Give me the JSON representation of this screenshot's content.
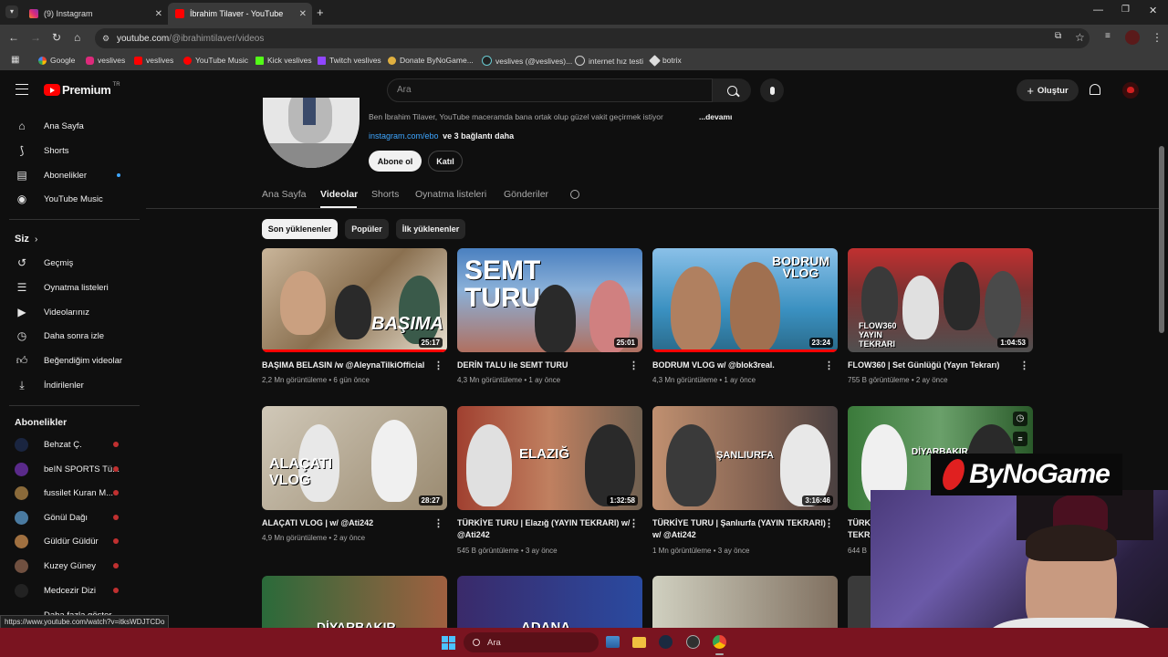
{
  "browser": {
    "tabs": [
      {
        "title": "(9) Instagram",
        "active": false
      },
      {
        "title": "İbrahim Tilaver - YouTube",
        "active": true
      }
    ],
    "url_main": "youtube.com",
    "url_path": "/@ibrahimtilaver/videos",
    "bookmarks": [
      "Google",
      "veslives",
      "veslives",
      "YouTube Music",
      "Kick veslives",
      "Twitch veslives",
      "Donate ByNoGame...",
      "veslives (@veslives)...",
      "internet hız testi",
      "botrix"
    ]
  },
  "youtube": {
    "logo_text": "Premium",
    "logo_sup": "TR",
    "search_placeholder": "Ara",
    "create_label": "Oluştur",
    "sidebar": {
      "main": [
        "Ana Sayfa",
        "Shorts",
        "Abonelikler",
        "YouTube Music"
      ],
      "you_header": "Siz",
      "you": [
        "Geçmiş",
        "Oynatma listeleri",
        "Videolarınız",
        "Daha sonra izle",
        "Beğendiğim videolar",
        "İndirilenler"
      ],
      "subs_header": "Abonelikler",
      "subs": [
        "Behzat Ç.",
        "beIN SPORTS Tü...",
        "fussilet Kuran M...",
        "Gönül Dağı",
        "Güldür Güldür",
        "Kuzey Güney",
        "Medcezir Dizi"
      ],
      "show_more": "Daha fazla göster"
    },
    "channel": {
      "description": "Ben İbrahim Tilaver, YouTube maceramda bana ortak olup güzel vakit geçirmek istiyor",
      "more": "...devamı",
      "link": "instagram.com/ebo",
      "link_more": "ve 3 bağlantı daha",
      "subscribe": "Abone ol",
      "join": "Katıl"
    },
    "channel_tabs": [
      "Ana Sayfa",
      "Videolar",
      "Shorts",
      "Oynatma listeleri",
      "Gönderiler"
    ],
    "active_channel_tab": "Videolar",
    "chips": [
      "Son yüklenenler",
      "Popüler",
      "İlk yüklenenler"
    ],
    "selected_chip": "Son yüklenenler",
    "videos": [
      {
        "title": "BAŞIMA BELASIN /w @AleynaTilkiOfficial",
        "views": "2,2 Mn görüntüleme",
        "age": "6 gün önce",
        "duration": "25:17",
        "thumb_text": "BAŞIMA",
        "watched_fraction": 1.0
      },
      {
        "title": "DERİN TALU ile SEMT TURU",
        "views": "4,3 Mn görüntüleme",
        "age": "1 ay önce",
        "duration": "25:01",
        "thumb_text": "SEMT TURU",
        "watched_fraction": 0
      },
      {
        "title": "BODRUM VLOG w/ @blok3real.",
        "views": "4,3 Mn görüntüleme",
        "age": "1 ay önce",
        "duration": "23:24",
        "thumb_text": "BODRUM VLOG",
        "watched_fraction": 1.0
      },
      {
        "title": "FLOW360 | Set Günlüğü (Yayın Tekrarı)",
        "views": "755 B görüntüleme",
        "age": "2 ay önce",
        "duration": "1:04:53",
        "thumb_text": "FLOW360 YAYIN TEKRARI",
        "watched_fraction": 0
      },
      {
        "title": "ALAÇATI VLOG | w/ @Ati242",
        "views": "4,9 Mn görüntüleme",
        "age": "2 ay önce",
        "duration": "28:27",
        "thumb_text": "ALAÇATI VLOG",
        "watched_fraction": 0
      },
      {
        "title": "TÜRKİYE TURU | Elazığ (YAYIN TEKRARI) w/ @Ati242",
        "views": "545 B görüntüleme",
        "age": "3 ay önce",
        "duration": "1:32:58",
        "thumb_text": "ELAZIĞ",
        "watched_fraction": 0
      },
      {
        "title": "TÜRKİYE TURU | Şanlıurfa (YAYIN TEKRARI) w/ @Ati242",
        "views": "1 Mn görüntüleme",
        "age": "3 ay önce",
        "duration": "3:16:46",
        "thumb_text": "ŞANLIURFA",
        "watched_fraction": 0
      },
      {
        "title": "TÜRKİYE TURU | Diyarbakır (YAYIN TEKRARI)",
        "views": "644 B",
        "age": "",
        "duration": "",
        "thumb_text": "DİYARBAKIR",
        "watched_fraction": 0
      }
    ],
    "row3_thumb_texts": [
      "DİYARBAKIR",
      "ADANA",
      "",
      ""
    ]
  },
  "status_url": "https://www.youtube.com/watch?v=itksWDJTCDo",
  "taskbar": {
    "search": "Ara"
  },
  "overlay": {
    "brand": "ByNoGame"
  },
  "colors": {
    "accent": "#ff0000",
    "taskbar": "#7a1420",
    "bg": "#0f0f0f"
  }
}
